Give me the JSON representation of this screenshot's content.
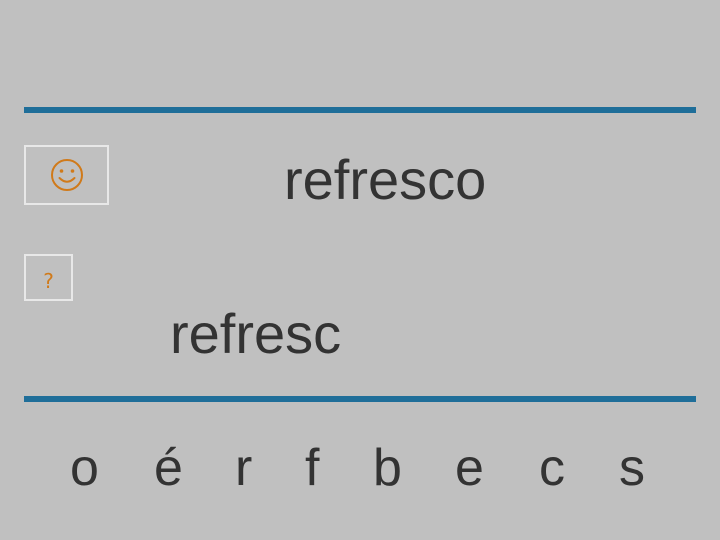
{
  "target_word": "refresco",
  "answer_word": "refresc",
  "help_button": {
    "label": "?"
  },
  "letters": [
    "o",
    "é",
    "r",
    "f",
    "b",
    "e",
    "c",
    "s"
  ],
  "colors": {
    "background": "#c0c0c0",
    "rule": "#1f6e99",
    "text": "#333333",
    "help": "#d07a1a",
    "icon": "#d07a1a"
  },
  "icons": {
    "feedback": "smiley-icon"
  }
}
